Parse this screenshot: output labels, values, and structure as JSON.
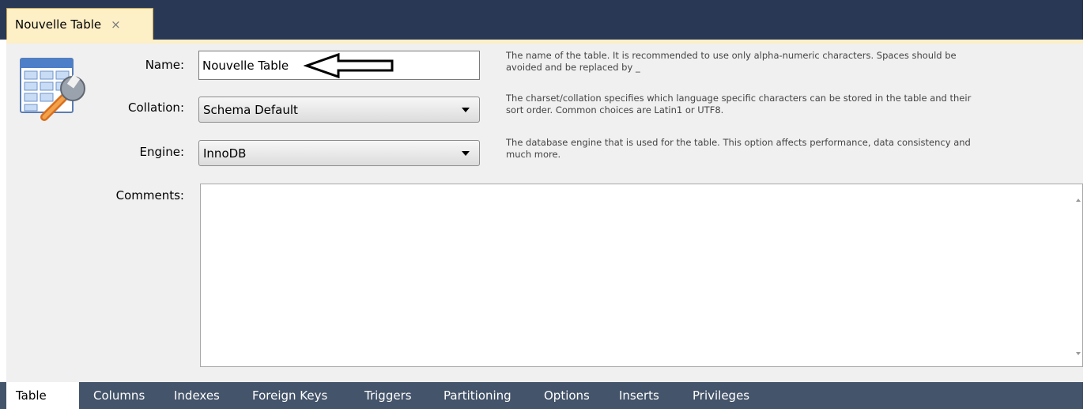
{
  "document_tab": {
    "title": "Nouvelle Table",
    "close_glyph": "×"
  },
  "icon": "table-settings-icon",
  "form": {
    "name": {
      "label": "Name:",
      "value": "Nouvelle Table",
      "help": "The name of the table. It is recommended to use only alpha-numeric characters. Spaces should be avoided and be replaced by _"
    },
    "collation": {
      "label": "Collation:",
      "value": "Schema Default",
      "help": "The charset/collation specifies which language specific characters can be stored in the table and their sort order. Common choices are Latin1 or UTF8."
    },
    "engine": {
      "label": "Engine:",
      "value": "InnoDB",
      "help": "The database engine that is used for the table. This option affects performance, data consistency and much more."
    },
    "comments": {
      "label": "Comments:",
      "value": ""
    }
  },
  "bottom_tabs": {
    "table": "Table",
    "columns": "Columns",
    "indexes": "Indexes",
    "foreign_keys": "Foreign Keys",
    "triggers": "Triggers",
    "partitioning": "Partitioning",
    "options": "Options",
    "inserts": "Inserts",
    "privileges": "Privileges"
  },
  "colors": {
    "top_bar": "#293955",
    "active_tab": "#fdefc6",
    "panel": "#f0f0f0",
    "bottom_bar": "#44546a"
  }
}
